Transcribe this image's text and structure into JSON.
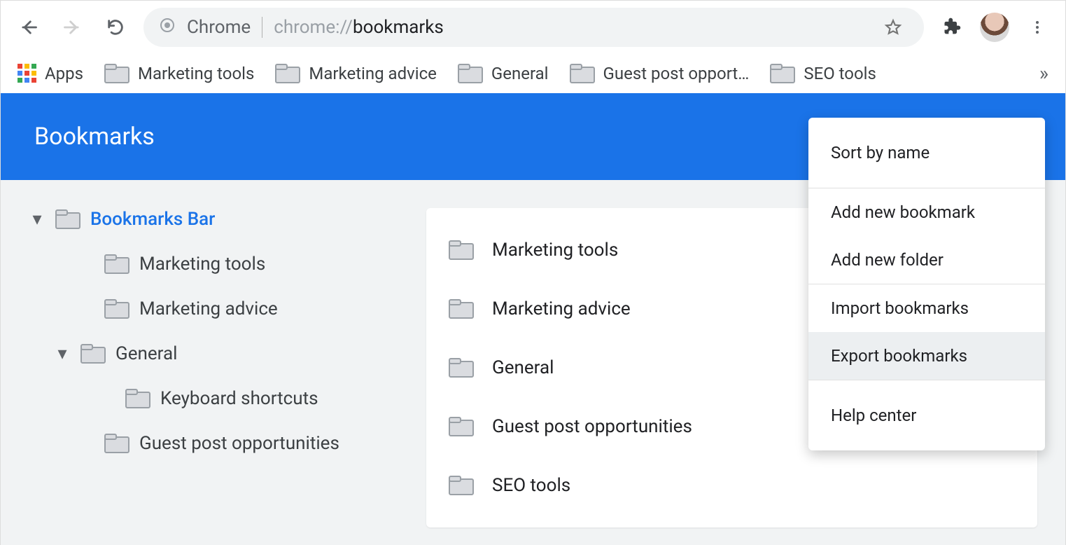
{
  "toolbar": {
    "site_label": "Chrome",
    "url_prefix": "chrome://",
    "url_path": "bookmarks"
  },
  "bookmarks_bar": {
    "apps_label": "Apps",
    "items": [
      {
        "label": "Marketing tools"
      },
      {
        "label": "Marketing advice"
      },
      {
        "label": "General"
      },
      {
        "label": "Guest post opport…"
      },
      {
        "label": "SEO tools"
      }
    ]
  },
  "header": {
    "title": "Bookmarks"
  },
  "sidebar": {
    "root_label": "Bookmarks Bar",
    "items": [
      {
        "label": "Marketing tools",
        "level": 1
      },
      {
        "label": "Marketing advice",
        "level": 1
      },
      {
        "label": "General",
        "level": 1,
        "expandable": true
      },
      {
        "label": "Keyboard shortcuts",
        "level": 2
      },
      {
        "label": "Guest post opportunities",
        "level": 1
      }
    ]
  },
  "main_list": {
    "items": [
      {
        "label": "Marketing tools"
      },
      {
        "label": "Marketing advice"
      },
      {
        "label": "General"
      },
      {
        "label": "Guest post opportunities"
      },
      {
        "label": "SEO tools"
      }
    ]
  },
  "menu": {
    "sort": "Sort by name",
    "add_bookmark": "Add new bookmark",
    "add_folder": "Add new folder",
    "import": "Import bookmarks",
    "export": "Export bookmarks",
    "help": "Help center"
  }
}
